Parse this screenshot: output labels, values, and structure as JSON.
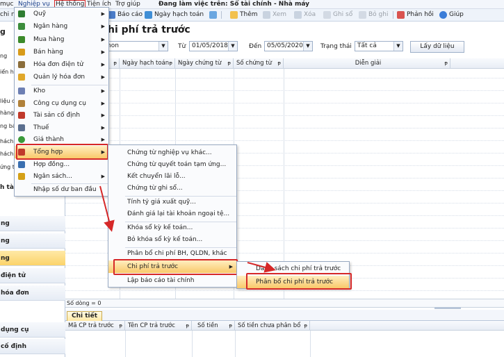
{
  "menubar": {
    "items": [
      "mục",
      "Nghiệp vụ",
      "Hệ thống",
      "Tiện ích",
      "Trợ giúp"
    ],
    "workspace": "Đang làm việc trên: Sổ tài chính - Nhà máy"
  },
  "toolbar": {
    "left_cut": "chi nh",
    "bao_cao": "Báo cáo",
    "ngay_hach_toan": "Ngày hạch toán",
    "them": "Thêm",
    "xem": "Xem",
    "xoa": "Xóa",
    "ghi_so": "Ghi sổ",
    "bo_ghi": "Bỏ ghi",
    "phan_hoi": "Phản hồi",
    "giup": "Giúp"
  },
  "leftnav": {
    "partial_items": [
      "g",
      "ng",
      "iến hà",
      "liệu ch",
      "hàng b",
      "ng bán",
      "hách h",
      "hách h",
      "ứng từ",
      "h tài"
    ],
    "sections": [
      "ng",
      "ng",
      "ng",
      "điện tử",
      "hóa đơn",
      "dụng cụ",
      "cố định"
    ],
    "active_index": 2
  },
  "main": {
    "title": "hi phí trả trước",
    "filter_combo": "non",
    "from_label": "Từ",
    "from_date": "01/05/2018",
    "to_label": "Đến",
    "to_date": "05/05/2020",
    "status_label": "Trạng thái",
    "status_value": "Tất cả",
    "load_button": "Lấy dữ liệu",
    "columns": [
      "Ngày hạch toán",
      "Ngày chứng từ",
      "Số chứng từ",
      "Diễn giải"
    ],
    "row_count": "Số dòng = 0",
    "detail_tab": "Chi tiết",
    "detail_columns": [
      "Mã CP trả trước",
      "Tên CP trả trước",
      "Số tiền",
      "Số tiền chưa phân bổ"
    ]
  },
  "menu_nghiepvu": {
    "items": [
      {
        "label": "Quỹ",
        "icon": "cash-icon",
        "color": "#2f7d32",
        "sub": true
      },
      {
        "label": "Ngân hàng",
        "icon": "bank-icon",
        "color": "#3c8d3c",
        "sub": true
      },
      {
        "label": "Mua hàng",
        "icon": "purchase-icon",
        "color": "#3b8a2a",
        "sub": true
      },
      {
        "label": "Bán hàng",
        "icon": "sales-icon",
        "color": "#d89b1a",
        "sub": true
      },
      {
        "label": "Hóa đơn điện tử",
        "icon": "einvoice-icon",
        "color": "#8a6d3b",
        "sub": true
      },
      {
        "label": "Quản lý hóa đơn",
        "icon": "invoice-icon",
        "color": "#e0a72a",
        "sub": true
      },
      {
        "label": "Kho",
        "icon": "warehouse-icon",
        "color": "#6d7fb3",
        "sub": true
      },
      {
        "label": "Công cụ dụng cụ",
        "icon": "tools-icon",
        "color": "#b0813a",
        "sub": true
      },
      {
        "label": "Tài sản cố định",
        "icon": "asset-icon",
        "color": "#c0392b",
        "sub": true
      },
      {
        "label": "Thuế",
        "icon": "tax-icon",
        "color": "#5b6f8f",
        "sub": true
      },
      {
        "label": "Giá thành",
        "icon": "cost-icon",
        "color": "#3a9a3a",
        "sub": true
      },
      {
        "label": "Tổng hợp",
        "icon": "summary-icon",
        "color": "#c0392b",
        "sub": true
      },
      {
        "label": "Hợp đồng...",
        "icon": "contract-icon",
        "color": "#3a6fb0",
        "sub": false
      },
      {
        "label": "Ngân sách...",
        "icon": "budget-icon",
        "color": "#d4a017",
        "sub": true
      },
      {
        "label": "Nhập số dư ban đầu",
        "icon": "",
        "color": "",
        "sub": false
      }
    ]
  },
  "menu_tonghop": {
    "items": [
      "Chứng từ nghiệp vụ khác...",
      "Chứng từ quyết toán tạm ứng...",
      "Kết chuyển lãi lỗ...",
      "Chứng từ ghi sổ...",
      "Tính tỷ giá xuất quỹ...",
      "Đánh giá lại tài khoản ngoại tệ...",
      "Khóa sổ kỳ kế toán...",
      "Bỏ khóa sổ kỳ kế toán...",
      "Phân bổ chi phí BH, QLDN, khác",
      "Chi phí trả trước",
      "Lập báo cáo tài chính"
    ]
  },
  "menu_chiphi": {
    "items": [
      "Danh sách chi phí trả trước",
      "Phân bổ chi phí trả trước"
    ]
  },
  "colors": {
    "highlight": "#f9c96a",
    "annotation": "#d62828"
  }
}
